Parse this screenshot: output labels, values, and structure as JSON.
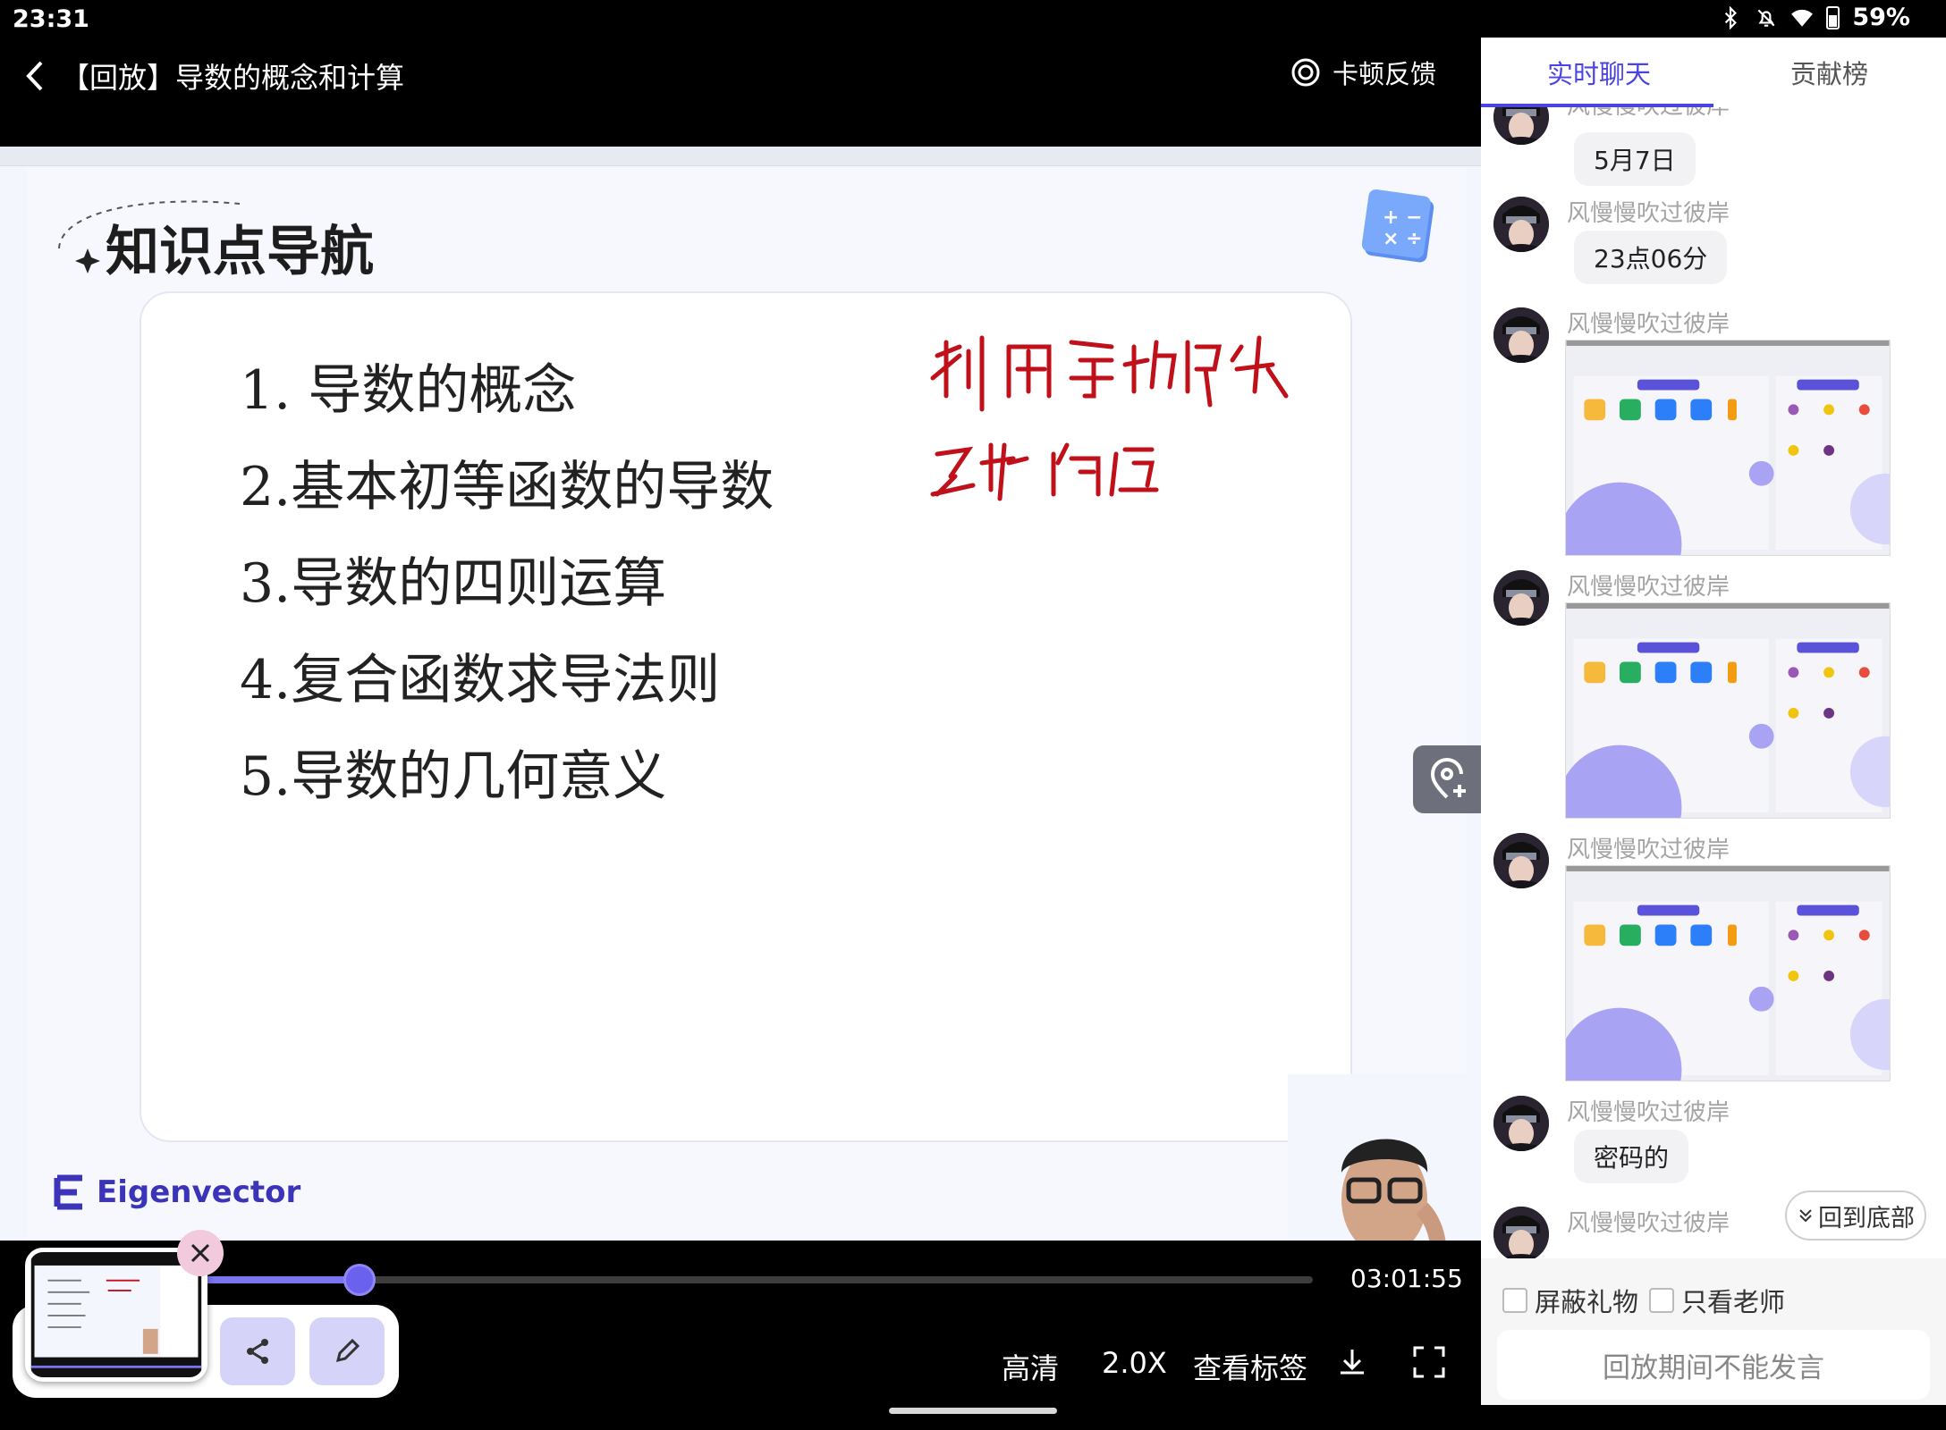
{
  "status_bar": {
    "time": "23:31",
    "battery": "59%"
  },
  "header": {
    "title": "【回放】导数的概念和计算",
    "lag_feedback": "卡顿反馈"
  },
  "slide": {
    "heading": "知识点导航",
    "items": [
      "1. 导数的概念",
      "2.基本初等函数的导数",
      "3.导数的四则运算",
      "4.复合函数求导法则",
      "5.导数的几何意义"
    ],
    "brand": "Eigenvector",
    "accent_color": "#4b44e0"
  },
  "player": {
    "progress": 0.14,
    "time": "03:01:55",
    "quality": "高清",
    "speed": "2.0X",
    "bookmarks": "查看标签"
  },
  "chat": {
    "tabs": [
      "实时聊天",
      "贡献榜"
    ],
    "messages": [
      {
        "sender": "风慢慢吹过彼岸",
        "text": "5月7日"
      },
      {
        "sender": "风慢慢吹过彼岸",
        "text": "23点06分"
      },
      {
        "sender": "风慢慢吹过彼岸",
        "text": ""
      },
      {
        "sender": "风慢慢吹过彼岸",
        "text": ""
      },
      {
        "sender": "风慢慢吹过彼岸",
        "text": ""
      },
      {
        "sender": "风慢慢吹过彼岸",
        "text": "密码的"
      },
      {
        "sender": "风慢慢吹过彼岸",
        "text": ""
      }
    ],
    "back_to_bottom": "回到底部",
    "block_gifts": "屏蔽礼物",
    "teacher_only": "只看老师",
    "input_placeholder": "回放期间不能发言"
  }
}
